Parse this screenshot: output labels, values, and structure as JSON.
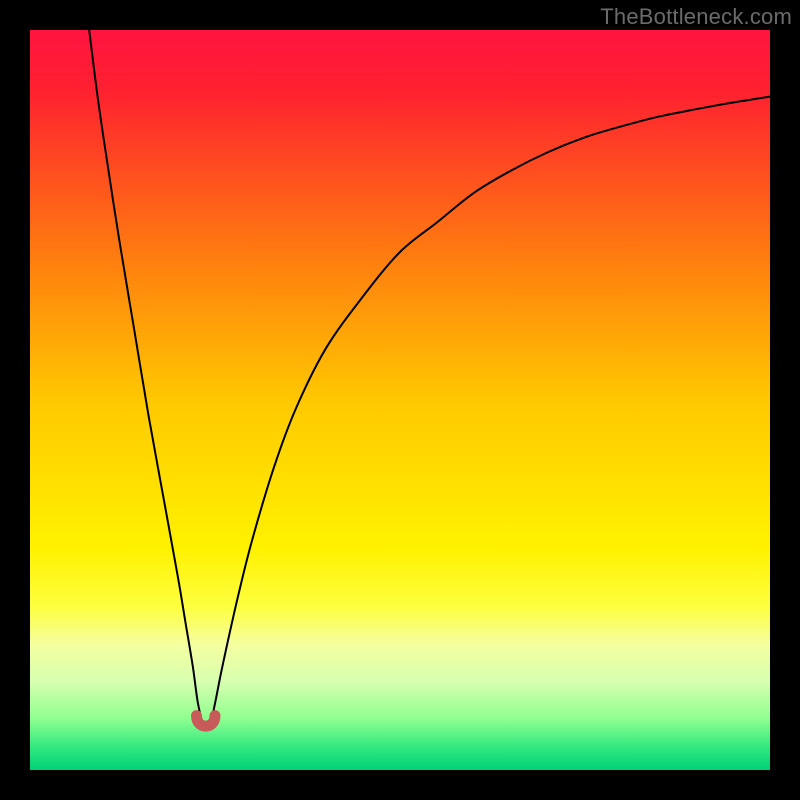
{
  "attribution": "TheBottleneck.com",
  "chart_data": {
    "type": "line",
    "title": "",
    "xlabel": "",
    "ylabel": "",
    "xlim": [
      0,
      100
    ],
    "ylim": [
      0,
      100
    ],
    "gradient_stops": [
      {
        "offset": 0.0,
        "color": "#ff1440"
      },
      {
        "offset": 0.08,
        "color": "#ff2030"
      },
      {
        "offset": 0.3,
        "color": "#ff7a10"
      },
      {
        "offset": 0.5,
        "color": "#ffc800"
      },
      {
        "offset": 0.7,
        "color": "#fff200"
      },
      {
        "offset": 0.78,
        "color": "#fdff40"
      },
      {
        "offset": 0.83,
        "color": "#f5ffa0"
      },
      {
        "offset": 0.88,
        "color": "#d8ffb0"
      },
      {
        "offset": 0.93,
        "color": "#90ff90"
      },
      {
        "offset": 0.97,
        "color": "#30e880"
      },
      {
        "offset": 1.0,
        "color": "#00d077"
      }
    ],
    "series": [
      {
        "name": "curve",
        "x": [
          8,
          9,
          10,
          12,
          14,
          16,
          18,
          20,
          21,
          22,
          22.7,
          23.5,
          24.3,
          25,
          26,
          28,
          30,
          33,
          36,
          40,
          45,
          50,
          55,
          60,
          65,
          70,
          75,
          80,
          85,
          90,
          95,
          100
        ],
        "y": [
          100,
          92,
          85,
          72,
          60,
          48,
          37,
          26,
          20,
          14,
          9,
          6,
          6,
          9,
          14,
          23,
          31,
          41,
          49,
          57,
          64,
          70,
          74,
          78,
          81,
          83.5,
          85.5,
          87,
          88.3,
          89.3,
          90.2,
          91
        ]
      }
    ],
    "marker": {
      "x_range": [
        22.5,
        25.0
      ],
      "y": 6,
      "color": "#c95a5a"
    }
  }
}
